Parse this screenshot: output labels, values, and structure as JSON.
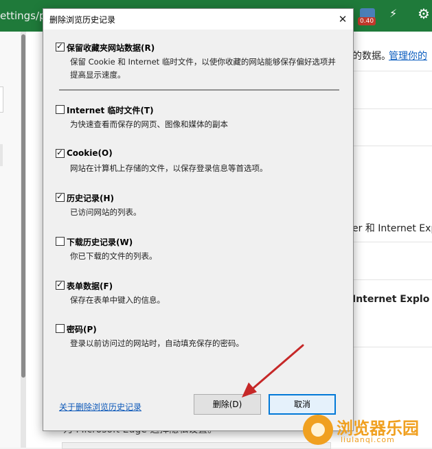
{
  "browser": {
    "url_fragment": "ettings/pri",
    "ext_badge": "0.40",
    "right_texts": {
      "data_suffix": "的数据。",
      "manage_link": "管理你的",
      "ie_text_1": "er 和 Internet Exp",
      "ie_text_2": "Internet Explo",
      "bottom_text": "为 Microsoft Edge 选择隐私设置。"
    }
  },
  "dialog": {
    "title": "删除浏览历史记录",
    "close_symbol": "✕",
    "options": [
      {
        "label": "保留收藏夹网站数据(R)",
        "checked": true,
        "desc": "保留 Cookie 和 Internet 临时文件，以使你收藏的网站能够保存偏好选项并提高显示速度。"
      },
      {
        "label": "Internet 临时文件(T)",
        "checked": false,
        "desc": "为快速查看而保存的网页、图像和媒体的副本"
      },
      {
        "label": "Cookie(O)",
        "checked": true,
        "desc": "网站在计算机上存储的文件，以保存登录信息等首选项。"
      },
      {
        "label": "历史记录(H)",
        "checked": true,
        "desc": "已访问网站的列表。"
      },
      {
        "label": "下载历史记录(W)",
        "checked": false,
        "desc": "你已下载的文件的列表。"
      },
      {
        "label": "表单数据(F)",
        "checked": true,
        "desc": "保存在表单中键入的信息。"
      },
      {
        "label": "密码(P)",
        "checked": false,
        "desc": "登录以前访问过的网站时，自动填充保存的密码。"
      }
    ],
    "help_link": "关于删除浏览历史记录",
    "delete_label": "删除(D)",
    "cancel_label": "取消"
  },
  "watermark": {
    "name": "浏览器乐园",
    "domain": "liulanqi.com"
  },
  "colors": {
    "accent": "#0078d7",
    "arrow": "#c62828"
  }
}
